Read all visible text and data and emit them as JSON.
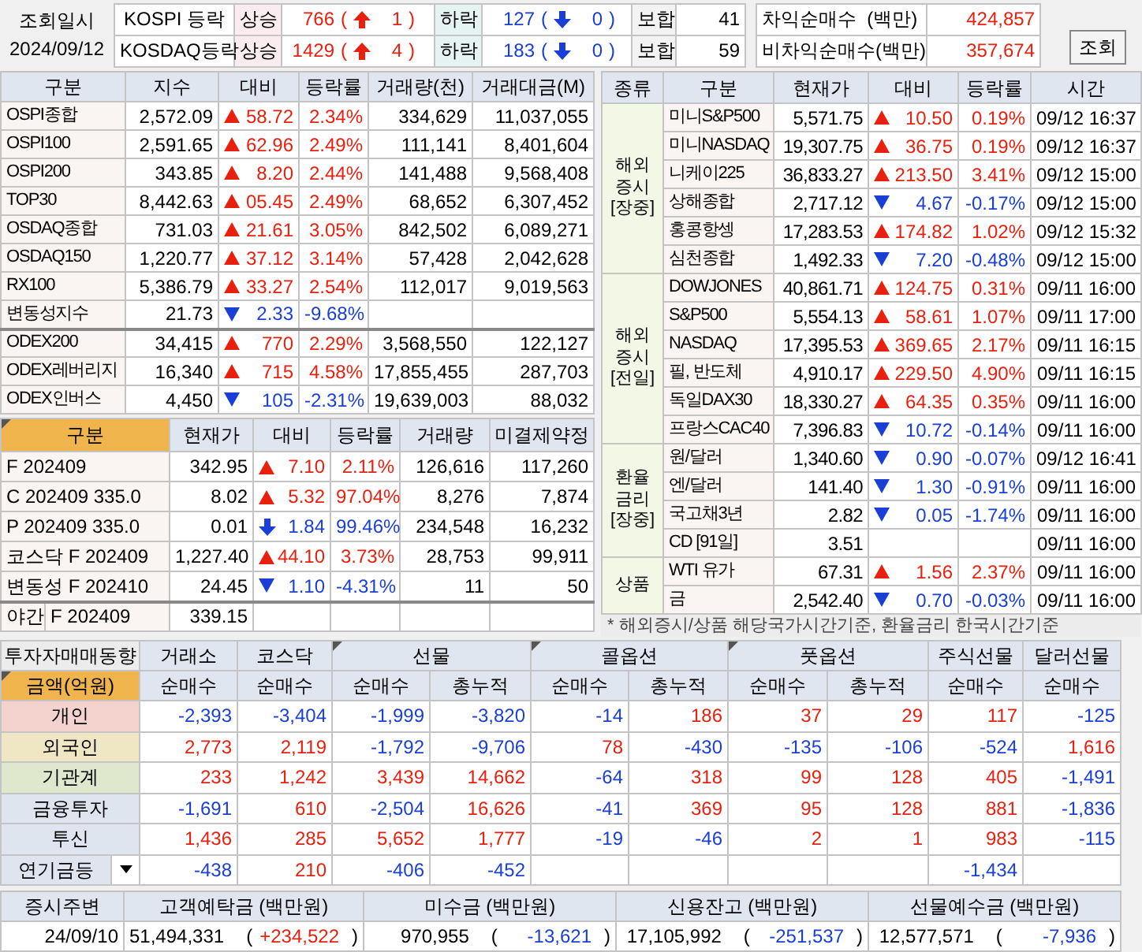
{
  "top": {
    "date_label": "조회일시",
    "date": "2024/09/12",
    "rows": [
      {
        "market": "KOSPI 등락",
        "rise_label": "상승",
        "rise": "766",
        "up_open": "(",
        "upper": "1",
        "up_close": ")",
        "fall_label": "하락",
        "fall": "127",
        "down_open": "(",
        "lower": "0",
        "down_close": ")",
        "flat_label": "보합",
        "flat": "41"
      },
      {
        "market": "KOSDAQ등락",
        "rise_label": "상승",
        "rise": "1429",
        "up_open": "(",
        "upper": "4",
        "up_close": ")",
        "fall_label": "하락",
        "fall": "183",
        "down_open": "(",
        "lower": "0",
        "down_close": ")",
        "flat_label": "보합",
        "flat": "59"
      }
    ],
    "net": [
      {
        "label": "차익순매수  (백만)",
        "value": "424,857"
      },
      {
        "label": "비차익순매수(백만)",
        "value": "357,674"
      }
    ],
    "button": "조회"
  },
  "index_table": {
    "columns": [
      "구분",
      "지수",
      "대비",
      "등락률",
      "거래량(천)",
      "거래대금(M)"
    ],
    "groups": [
      {
        "rows": [
          {
            "name": "OSPI종합",
            "value": "2,572.09",
            "kind": "rise",
            "change": "58.72",
            "rate": "2.34%",
            "volume": "334,629",
            "amount": "11,037,055"
          },
          {
            "name": "OSPI100",
            "value": "2,591.65",
            "kind": "rise",
            "change": "62.96",
            "rate": "2.49%",
            "volume": "111,141",
            "amount": "8,401,604"
          },
          {
            "name": "OSPI200",
            "value": "343.85",
            "kind": "rise",
            "change": "8.20",
            "rate": "2.44%",
            "volume": "141,488",
            "amount": "9,568,408"
          },
          {
            "name": "TOP30",
            "value": "8,442.63",
            "kind": "rise",
            "change": "05.45",
            "rate": "2.49%",
            "volume": "68,652",
            "amount": "6,307,452"
          },
          {
            "name": "OSDAQ종합",
            "value": "731.03",
            "kind": "rise",
            "change": "21.61",
            "rate": "3.05%",
            "volume": "842,502",
            "amount": "6,089,271"
          },
          {
            "name": "OSDAQ150",
            "value": "1,220.77",
            "kind": "rise",
            "change": "37.12",
            "rate": "3.14%",
            "volume": "57,428",
            "amount": "2,042,628"
          },
          {
            "name": "RX100",
            "value": "5,386.79",
            "kind": "rise",
            "change": "33.27",
            "rate": "2.54%",
            "volume": "112,017",
            "amount": "9,019,563"
          },
          {
            "name": "변동성지수",
            "value": "21.73",
            "kind": "fall",
            "change": "2.33",
            "rate": "-9.68%"
          }
        ]
      },
      {
        "rows": [
          {
            "name": "ODEX200",
            "value": "34,415",
            "kind": "rise",
            "change": "770",
            "rate": "2.29%",
            "volume": "3,568,550",
            "amount": "122,127"
          },
          {
            "name": "ODEX레버리지",
            "value": "16,340",
            "kind": "rise",
            "change": "715",
            "rate": "4.58%",
            "volume": "17,855,455",
            "amount": "287,703"
          },
          {
            "name": "ODEX인버스",
            "value": "4,450",
            "kind": "fall",
            "change": "105",
            "rate": "-2.31%",
            "volume": "19,639,003",
            "amount": "88,032"
          }
        ]
      }
    ]
  },
  "futures_table": {
    "columns": [
      "구분",
      "현재가",
      "대비",
      "등락률",
      "거래량",
      "미결제약정"
    ],
    "rows": [
      {
        "name": "F 202409",
        "price": "342.95",
        "kind": "rise",
        "change": "7.10",
        "rate": "2.11%",
        "volume": "126,616",
        "open_interest": "117,260"
      },
      {
        "name": "C 202409 335.0",
        "price": "8.02",
        "kind": "rise",
        "change": "5.32",
        "rate": "97.04%",
        "volume": "8,276",
        "open_interest": "7,874"
      },
      {
        "name": "P 202409 335.0",
        "price": "0.01",
        "kind": "drop",
        "change": "1.84",
        "rate": "99.46%",
        "volume": "234,548",
        "open_interest": "16,232"
      },
      {
        "name": "코스닥 F 202409",
        "price": "1,227.40",
        "kind": "rise",
        "change": "44.10",
        "rate": "3.73%",
        "volume": "28,753",
        "open_interest": "99,911"
      },
      {
        "name": "변동성 F 202410",
        "price": "24.45",
        "kind": "fall",
        "change": "1.10",
        "rate": "-4.31%",
        "volume": "11",
        "open_interest": "50"
      },
      {
        "kind": "night",
        "session": "야간",
        "name": "F 202409",
        "price": "339.15"
      }
    ]
  },
  "world_table": {
    "columns": [
      "종류",
      "구분",
      "현재가",
      "대비",
      "등락률",
      "시간"
    ],
    "groups": [
      {
        "category": [
          "해외",
          "증시",
          "[장중]"
        ],
        "rows": [
          {
            "name": "미니S&P500",
            "price": "5,571.75",
            "kind": "rise",
            "change": "10.50",
            "rate": "0.19%",
            "time": "09/12 16:37"
          },
          {
            "name": "미니NASDAQ",
            "price": "19,307.75",
            "kind": "rise",
            "change": "36.75",
            "rate": "0.19%",
            "time": "09/12 16:37"
          },
          {
            "name": "니케이225",
            "price": "36,833.27",
            "kind": "rise",
            "change": "213.50",
            "rate": "3.41%",
            "time": "09/12 15:00"
          },
          {
            "name": "상해종합",
            "price": "2,717.12",
            "kind": "fall",
            "change": "4.67",
            "rate": "-0.17%",
            "time": "09/12 15:00"
          },
          {
            "name": "홍콩항셍",
            "price": "17,283.53",
            "kind": "rise",
            "change": "174.82",
            "rate": "1.02%",
            "time": "09/12 15:32"
          },
          {
            "name": "심천종합",
            "price": "1,492.33",
            "kind": "fall",
            "change": "7.20",
            "rate": "-0.48%",
            "time": "09/12 15:00"
          }
        ]
      },
      {
        "category": [
          "해외",
          "증시",
          "[전일]"
        ],
        "rows": [
          {
            "name": "DOWJONES",
            "price": "40,861.71",
            "kind": "rise",
            "change": "124.75",
            "rate": "0.31%",
            "time": "09/11 16:00"
          },
          {
            "name": "S&P500",
            "price": "5,554.13",
            "kind": "rise",
            "change": "58.61",
            "rate": "1.07%",
            "time": "09/11 17:00"
          },
          {
            "name": "NASDAQ",
            "price": "17,395.53",
            "kind": "rise",
            "change": "369.65",
            "rate": "2.17%",
            "time": "09/11 16:15"
          },
          {
            "name": "필, 반도체",
            "price": "4,910.17",
            "kind": "rise",
            "change": "229.50",
            "rate": "4.90%",
            "time": "09/11 16:15"
          },
          {
            "name": "독일DAX30",
            "price": "18,330.27",
            "kind": "rise",
            "change": "64.35",
            "rate": "0.35%",
            "time": "09/11 16:00"
          },
          {
            "name": "프랑스CAC40",
            "price": "7,396.83",
            "kind": "fall",
            "change": "10.72",
            "rate": "-0.14%",
            "time": "09/11 16:00"
          }
        ]
      },
      {
        "category": [
          "환율",
          "금리",
          "[장중]"
        ],
        "rows": [
          {
            "name": "원/달러",
            "price": "1,340.60",
            "kind": "fall",
            "change": "0.90",
            "rate": "-0.07%",
            "time": "09/12 16:41"
          },
          {
            "name": "엔/달러",
            "price": "141.40",
            "kind": "fall",
            "change": "1.30",
            "rate": "-0.91%",
            "time": "09/11 16:00"
          },
          {
            "name": "국고채3년",
            "price": "2.82",
            "kind": "fall",
            "change": "0.05",
            "rate": "-1.74%",
            "time": "09/11 16:00"
          },
          {
            "name": "CD [91일]",
            "price": "3.51",
            "kind": "plain",
            "time": "09/11 16:00"
          }
        ]
      },
      {
        "category": [
          "상품"
        ],
        "rows": [
          {
            "name": "WTI 유가",
            "price": "67.31",
            "kind": "rise",
            "change": "1.56",
            "rate": "2.37%",
            "time": "09/11 16:00"
          },
          {
            "name": "금",
            "price": "2,542.40",
            "kind": "fall",
            "change": "0.70",
            "rate": "-0.03%",
            "time": "09/11 16:00"
          }
        ]
      }
    ],
    "note": "* 해외증시/상품 해당국가시간기준, 환율금리 한국시간기준"
  },
  "investor_table": {
    "title": "투자자매매동향",
    "unit": "금액(억원)",
    "unit_flag": true,
    "groups": [
      {
        "label": "거래소",
        "flag": false,
        "subs": [
          "순매수"
        ]
      },
      {
        "label": "코스닥",
        "flag": false,
        "subs": [
          "순매수"
        ]
      },
      {
        "label": "선물",
        "flag": true,
        "subs": [
          "순매수",
          "총누적"
        ]
      },
      {
        "label": "콜옵션",
        "flag": true,
        "subs": [
          "순매수",
          "총누적"
        ]
      },
      {
        "label": "풋옵션",
        "flag": true,
        "subs": [
          "순매수",
          "총누적"
        ]
      },
      {
        "label": "주식선물",
        "flag": false,
        "subs": [
          "순매수"
        ]
      },
      {
        "label": "달러선물",
        "flag": false,
        "subs": [
          "순매수"
        ]
      }
    ],
    "rows": [
      {
        "kind": "label",
        "label": "개인",
        "color": "#f4d3cf",
        "cells": [
          {
            "kind": "value",
            "text": "-2,393"
          },
          {
            "kind": "value",
            "text": "-3,404"
          },
          {
            "kind": "value",
            "text": "-1,999"
          },
          {
            "kind": "value",
            "text": "-3,820"
          },
          {
            "kind": "value",
            "text": "-14"
          },
          {
            "kind": "value",
            "text": "186"
          },
          {
            "kind": "value",
            "text": "37"
          },
          {
            "kind": "value",
            "text": "29"
          },
          {
            "kind": "value",
            "text": "117"
          },
          {
            "kind": "value",
            "text": "-125"
          }
        ]
      },
      {
        "kind": "label",
        "label": "외국인",
        "color": "#efe6c4",
        "cells": [
          {
            "kind": "value",
            "text": "2,773"
          },
          {
            "kind": "value",
            "text": "2,119"
          },
          {
            "kind": "value",
            "text": "-1,792"
          },
          {
            "kind": "value",
            "text": "-9,706"
          },
          {
            "kind": "value",
            "text": "78"
          },
          {
            "kind": "value",
            "text": "-430"
          },
          {
            "kind": "value",
            "text": "-135"
          },
          {
            "kind": "value",
            "text": "-106"
          },
          {
            "kind": "value",
            "text": "-524"
          },
          {
            "kind": "value",
            "text": "1,616"
          }
        ]
      },
      {
        "kind": "label",
        "label": "기관계",
        "color": "#dfe7cd",
        "cells": [
          {
            "kind": "value",
            "text": "233"
          },
          {
            "kind": "value",
            "text": "1,242"
          },
          {
            "kind": "value",
            "text": "3,439"
          },
          {
            "kind": "value",
            "text": "14,662"
          },
          {
            "kind": "value",
            "text": "-64"
          },
          {
            "kind": "value",
            "text": "318"
          },
          {
            "kind": "value",
            "text": "99"
          },
          {
            "kind": "value",
            "text": "128"
          },
          {
            "kind": "value",
            "text": "405"
          },
          {
            "kind": "value",
            "text": "-1,491"
          }
        ]
      },
      {
        "kind": "label",
        "label": "금융투자",
        "color": "#dfe5ef",
        "cells": [
          {
            "kind": "value",
            "text": "-1,691"
          },
          {
            "kind": "value",
            "text": "610"
          },
          {
            "kind": "value",
            "text": "-2,504"
          },
          {
            "kind": "value",
            "text": "16,626"
          },
          {
            "kind": "value",
            "text": "-41"
          },
          {
            "kind": "value",
            "text": "369"
          },
          {
            "kind": "value",
            "text": "95"
          },
          {
            "kind": "value",
            "text": "128"
          },
          {
            "kind": "value",
            "text": "881"
          },
          {
            "kind": "value",
            "text": "-1,836"
          }
        ]
      },
      {
        "kind": "label",
        "label": "투신",
        "color": "#dfe5ef",
        "cells": [
          {
            "kind": "value",
            "text": "1,436"
          },
          {
            "kind": "value",
            "text": "285"
          },
          {
            "kind": "value",
            "text": "5,652"
          },
          {
            "kind": "value",
            "text": "1,777"
          },
          {
            "kind": "value",
            "text": "-19"
          },
          {
            "kind": "value",
            "text": "-46"
          },
          {
            "kind": "value",
            "text": "2"
          },
          {
            "kind": "value",
            "text": "1"
          },
          {
            "kind": "value",
            "text": "983"
          },
          {
            "kind": "value",
            "text": "-115"
          }
        ]
      },
      {
        "kind": "dropdown",
        "label": "연기금등",
        "color": "#dfe5ef",
        "cells": [
          {
            "kind": "value",
            "text": "-438"
          },
          {
            "kind": "value",
            "text": "210"
          },
          {
            "kind": "value",
            "text": "-406"
          },
          {
            "kind": "value",
            "text": "-452"
          },
          {
            "kind": "empty"
          },
          {
            "kind": "empty"
          },
          {
            "kind": "empty"
          },
          {
            "kind": "empty"
          },
          {
            "kind": "value",
            "text": "-1,434"
          },
          {
            "kind": "empty"
          }
        ]
      }
    ]
  },
  "market_funds": {
    "columns": [
      "증시주변",
      "고객예탁금 (백만원)",
      "미수금 (백만원)",
      "신용잔고 (백만원)",
      "선물예수금 (백만원)"
    ],
    "date": "24/09/10",
    "items": [
      {
        "value": "51,494,331",
        "open": "(",
        "change": "+234,522",
        "close": ")"
      },
      {
        "value": "970,955",
        "open": "(",
        "change": "-13,621",
        "close": ")"
      },
      {
        "value": "17,105,992",
        "open": "(",
        "change": "-251,537",
        "close": ")"
      },
      {
        "value": "12,577,571",
        "open": "(",
        "change": "-7,936",
        "close": ")"
      }
    ]
  }
}
